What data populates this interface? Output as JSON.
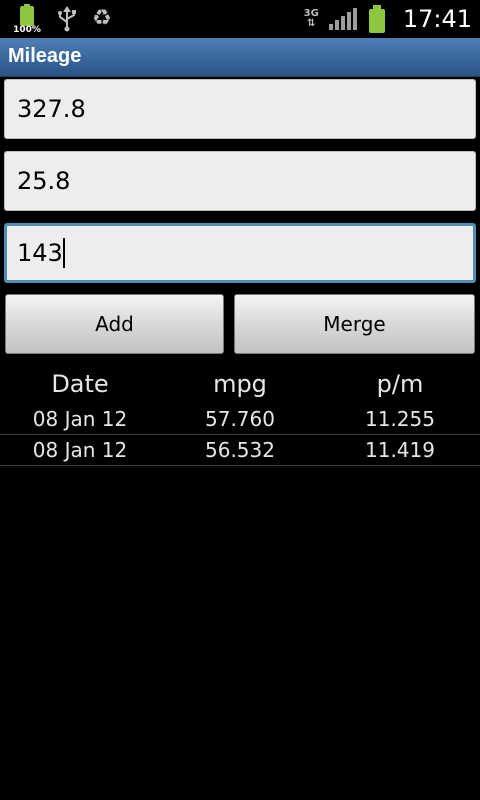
{
  "status_bar": {
    "battery_percent_label": "100%",
    "network_type": "3G",
    "time": "17:41",
    "icons": [
      "battery-icon",
      "usb-icon",
      "recycle-icon",
      "network-3g-icon",
      "signal-strength-icon",
      "battery-icon"
    ],
    "battery_color": "#8ec63f"
  },
  "app": {
    "title": "Mileage",
    "title_bar_color": "#3a6aa2"
  },
  "fields": [
    {
      "value": "327.8",
      "focused": false
    },
    {
      "value": "25.8",
      "focused": false
    },
    {
      "value": "143",
      "focused": true
    }
  ],
  "buttons": {
    "add_label": "Add",
    "merge_label": "Merge"
  },
  "table": {
    "headers": [
      "Date",
      "mpg",
      "p/m"
    ],
    "rows": [
      [
        "08 Jan 12",
        "57.760",
        "11.255"
      ],
      [
        "08 Jan 12",
        "56.532",
        "11.419"
      ]
    ]
  }
}
